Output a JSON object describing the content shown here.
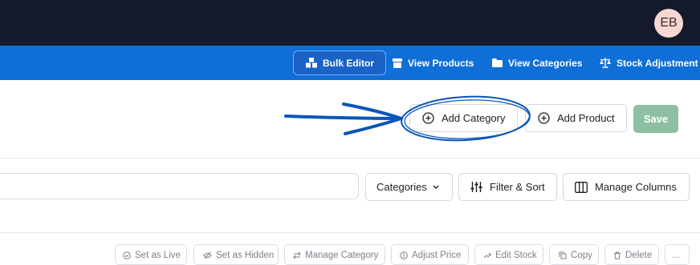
{
  "header": {
    "avatar_initials": "EB"
  },
  "nav": {
    "items": [
      {
        "label": "Bulk Editor",
        "icon": "boxes-icon",
        "active": true
      },
      {
        "label": "View Products",
        "icon": "box-icon"
      },
      {
        "label": "View Categories",
        "icon": "folder-icon"
      },
      {
        "label": "Stock Adjustment",
        "icon": "scale-icon"
      }
    ]
  },
  "toolbar": {
    "add_category_label": "Add Category",
    "add_product_label": "Add Product",
    "save_label": "Save"
  },
  "filters": {
    "categories_label": "Categories",
    "filter_sort_label": "Filter & Sort",
    "manage_columns_label": "Manage Columns"
  },
  "bulk_actions": {
    "set_live": "Set as Live",
    "set_hidden": "Set as Hidden",
    "manage_category": "Manage Category",
    "adjust_price": "Adjust Price",
    "edit_stock": "Edit Stock",
    "copy": "Copy",
    "delete": "Delete",
    "more": "..."
  },
  "colors": {
    "topbar": "#141a2b",
    "navbar": "#0f6fd6",
    "save_disabled": "#8fbfa3",
    "annotation": "#0a56b8"
  }
}
